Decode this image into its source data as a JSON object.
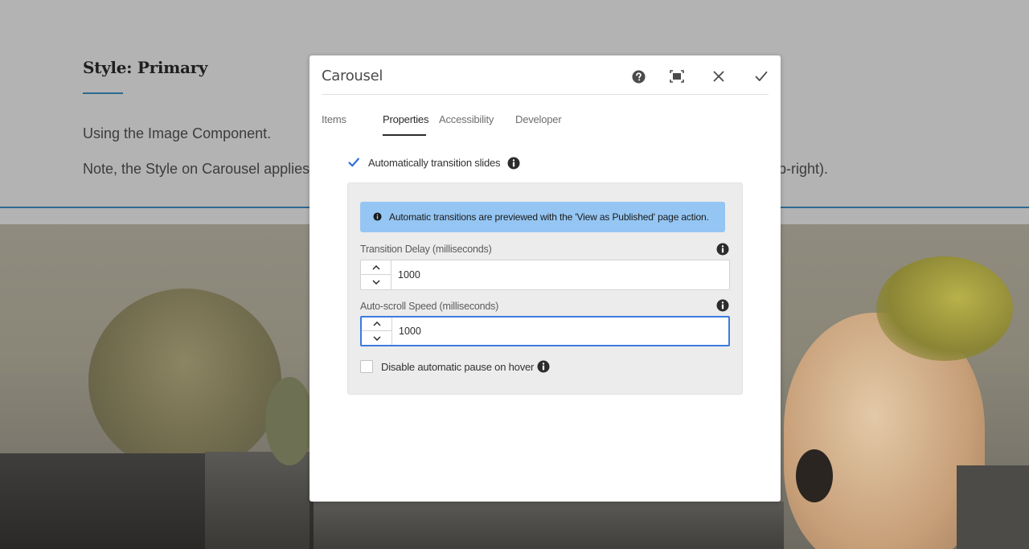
{
  "background_page": {
    "heading": "Style: Primary",
    "paragraph_1": "Using the Image Component.",
    "paragraph_2_visible": "Note, the Style on Carousel applies",
    "paragraph_2_tail": "p-right)."
  },
  "dialog": {
    "title": "Carousel",
    "header_icons": [
      "help-icon",
      "fullscreen-icon",
      "close-icon",
      "done-check-icon"
    ],
    "tabs": [
      {
        "label": "Items",
        "selected": false
      },
      {
        "label": "Properties",
        "selected": true
      },
      {
        "label": "Accessibility",
        "selected": false
      },
      {
        "label": "Developer",
        "selected": false
      }
    ],
    "auto_transition": {
      "label": "Automatically transition slides",
      "checked": true
    },
    "alert": "Automatic transitions are previewed with the 'View as Published' page action.",
    "transition_delay": {
      "label": "Transition Delay (milliseconds)",
      "value": "1000"
    },
    "autoscroll_speed": {
      "label": "Auto-scroll Speed (milliseconds)",
      "value": "1000"
    },
    "disable_pause": {
      "label": "Disable automatic pause on hover",
      "checked": false
    }
  },
  "colors": {
    "accent_blue": "#3c7be0",
    "alert_bg": "#95c6f3",
    "heading_rule": "#2b6a8f"
  }
}
